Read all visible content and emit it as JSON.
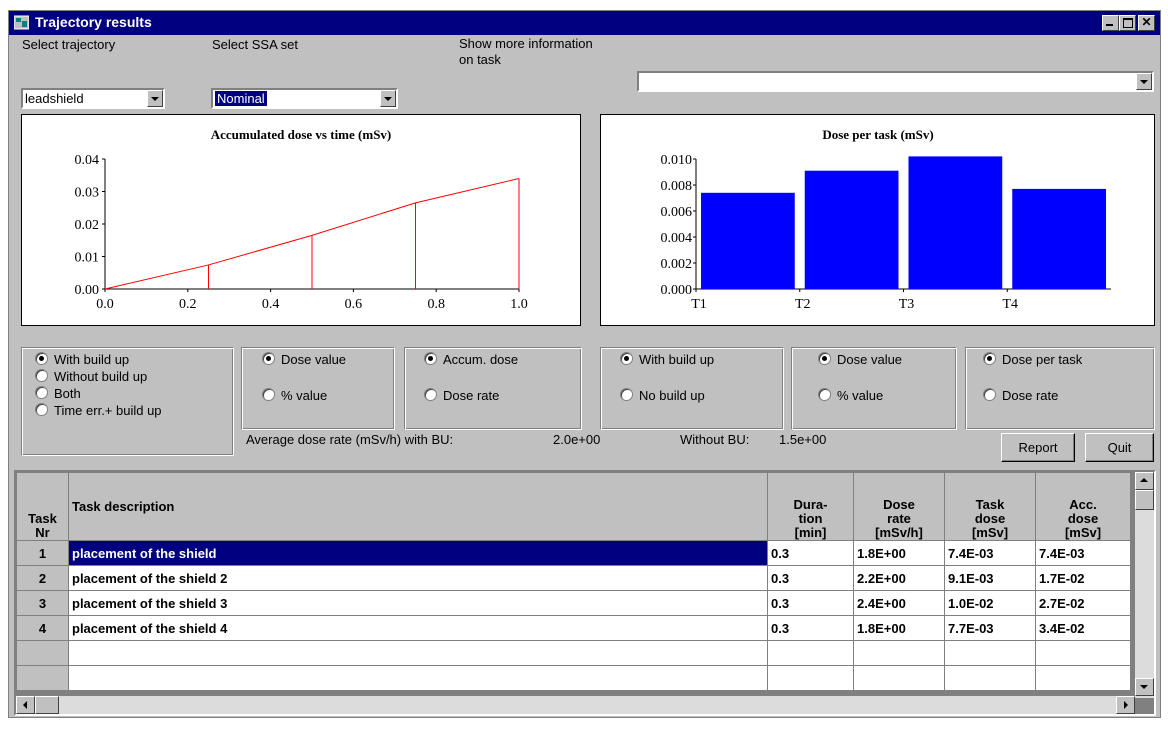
{
  "window": {
    "title": "Trajectory results",
    "icon": "app-window-icon"
  },
  "controls": {
    "select_trajectory_label": "Select trajectory",
    "trajectory_value": "leadshield",
    "select_ssa_label": "Select SSA set",
    "ssa_value": "Nominal",
    "more_info_label_line1": "Show more information",
    "more_info_label_line2": "on task",
    "more_info_value": ""
  },
  "chart_left": {
    "title": "Accumulated dose vs time (mSv)",
    "type": "line",
    "color": "#ff0000",
    "x": [
      0.0,
      0.25,
      0.5,
      0.75,
      1.0
    ],
    "y": [
      0.0,
      0.0074,
      0.0165,
      0.0265,
      0.034
    ],
    "xlim": [
      0.0,
      1.0
    ],
    "ylim": [
      0.0,
      0.04
    ],
    "xticks": [
      "0.0",
      "0.2",
      "0.4",
      "0.6",
      "0.8",
      "1.0"
    ],
    "yticks": [
      "0.00",
      "0.01",
      "0.02",
      "0.03",
      "0.04"
    ]
  },
  "chart_right": {
    "title": "Dose per task (mSv)",
    "type": "bar",
    "color": "#0000ff",
    "categories": [
      "T1",
      "T2",
      "T3",
      "T4"
    ],
    "values": [
      0.0074,
      0.0091,
      0.0102,
      0.0077
    ],
    "ylim": [
      0.0,
      0.01
    ],
    "yticks": [
      "0.000",
      "0.002",
      "0.004",
      "0.006",
      "0.008",
      "0.010"
    ]
  },
  "options": {
    "buildup": {
      "items": [
        "With build up",
        "Without build up",
        "Both",
        "Time err.+ build up"
      ],
      "selected": 0
    },
    "value_left": {
      "items": [
        "Dose value",
        "% value"
      ],
      "selected": 0
    },
    "accum_left": {
      "items": [
        "Accum. dose",
        "Dose rate"
      ],
      "selected": 0
    },
    "buildup_right": {
      "items": [
        "With build up",
        "No build up"
      ],
      "selected": 0
    },
    "value_right": {
      "items": [
        "Dose value",
        "% value"
      ],
      "selected": 0
    },
    "pertask_right": {
      "items": [
        "Dose per task",
        "Dose rate"
      ],
      "selected": 0
    }
  },
  "summary": {
    "avg_label": "Average dose rate (mSv/h) with BU:",
    "avg_value": "2.0e+00",
    "without_label": "Without BU:",
    "without_value": "1.5e+00"
  },
  "buttons": {
    "report": "Report",
    "quit": "Quit"
  },
  "table": {
    "headers": {
      "nr": [
        "Task",
        "Nr"
      ],
      "desc": "Task description",
      "duration": [
        "Dura-",
        "tion",
        "[min]"
      ],
      "rate": [
        "Dose",
        "rate",
        "[mSv/h]"
      ],
      "task_dose": [
        "Task",
        "dose",
        "[mSv]"
      ],
      "acc_dose": [
        "Acc.",
        "dose",
        "[mSv]"
      ]
    },
    "rows": [
      {
        "nr": "1",
        "desc": "placement of the shield",
        "duration": "0.3",
        "rate": "1.8E+00",
        "task_dose": "7.4E-03",
        "acc_dose": "7.4E-03"
      },
      {
        "nr": "2",
        "desc": "placement of the shield 2",
        "duration": "0.3",
        "rate": "2.2E+00",
        "task_dose": "9.1E-03",
        "acc_dose": "1.7E-02"
      },
      {
        "nr": "3",
        "desc": "placement of the shield 3",
        "duration": "0.3",
        "rate": "2.4E+00",
        "task_dose": "1.0E-02",
        "acc_dose": "2.7E-02"
      },
      {
        "nr": "4",
        "desc": "placement of the shield 4",
        "duration": "0.3",
        "rate": "1.8E+00",
        "task_dose": "7.7E-03",
        "acc_dose": "3.4E-02"
      }
    ],
    "selected_row": 0
  }
}
